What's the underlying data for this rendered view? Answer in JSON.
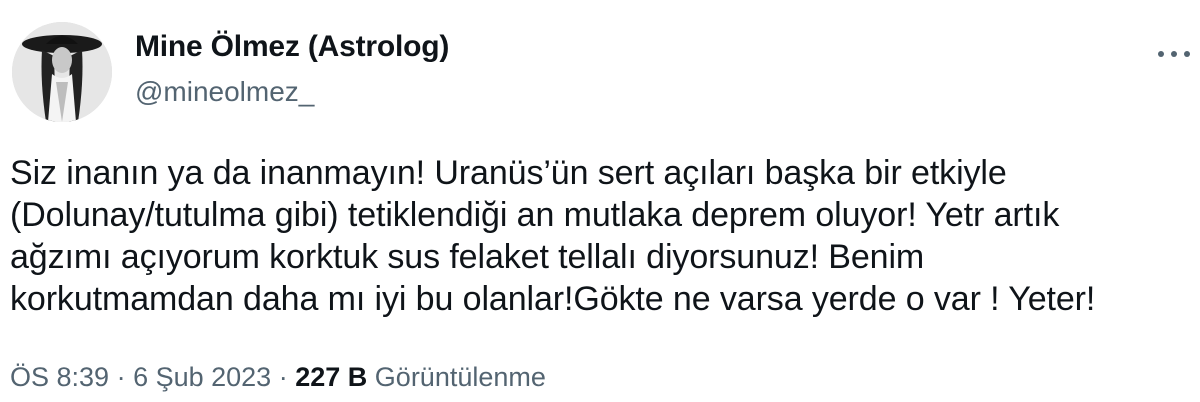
{
  "tweet": {
    "author_name": "Mine Ölmez (Astrolog)",
    "author_handle": "@mineolmez_",
    "text": "Siz inanın ya da inanmayın! Uranüs’ün sert açıları başka bir etkiyle\n(Dolunay/tutulma gibi) tetiklendiği an mutlaka deprem oluyor! Yetr artık\nağzımı açıyorum korktuk sus felaket tellalı diyorsunuz! Benim\nkorkutmamdan daha mı iyi bu olanlar!Gökte ne varsa yerde o var ! Yeter!",
    "time": "ÖS 8:39",
    "separator": "·",
    "date": "6 Şub 2023",
    "views_count": "227 B",
    "views_label": "Görüntülenme",
    "more_icon": "more-horizontal-icon"
  },
  "colors": {
    "text_primary": "#0f1419",
    "text_secondary": "#536471",
    "background": "#ffffff"
  }
}
